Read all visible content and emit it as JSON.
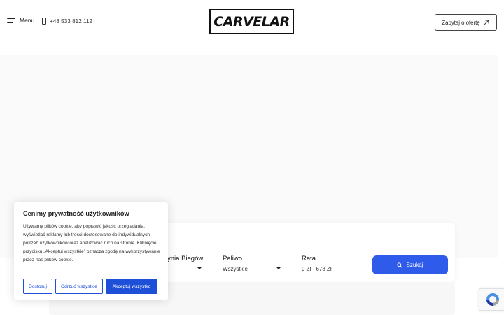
{
  "header": {
    "menu_label": "Menu",
    "phone": "+48 533 812 112",
    "logo_text": "CARVELAR",
    "quote_label": "Zapytaj o ofertę"
  },
  "search": {
    "fields": [
      {
        "label": "Skrzynia Biegów",
        "value": ""
      },
      {
        "label": "Paliwo",
        "value": "Wszystkie"
      },
      {
        "label": "Rata",
        "value": "0 Zł - 678 Zł"
      }
    ],
    "button_label": "Szukaj"
  },
  "cookie": {
    "title": "Cenimy prywatność użytkowników",
    "body": "Używamy plików cookie, aby poprawić jakość przeglądania, wyświetlać reklamy lub treści dostosowane do indywidualnych potrzeb użytkowników oraz analizować ruch na stronie. Kliknięcie przycisku „Akceptuj wszystkie” oznacza zgodę na wykorzystywanie przez nas plików cookie.",
    "btn_customize": "Dostosuj",
    "btn_reject": "Odrzuć wszystkie",
    "btn_accept": "Akceptuj wszystko"
  },
  "colors": {
    "accent": "#2e5bea",
    "cookie_accent": "#1e4fd8"
  }
}
